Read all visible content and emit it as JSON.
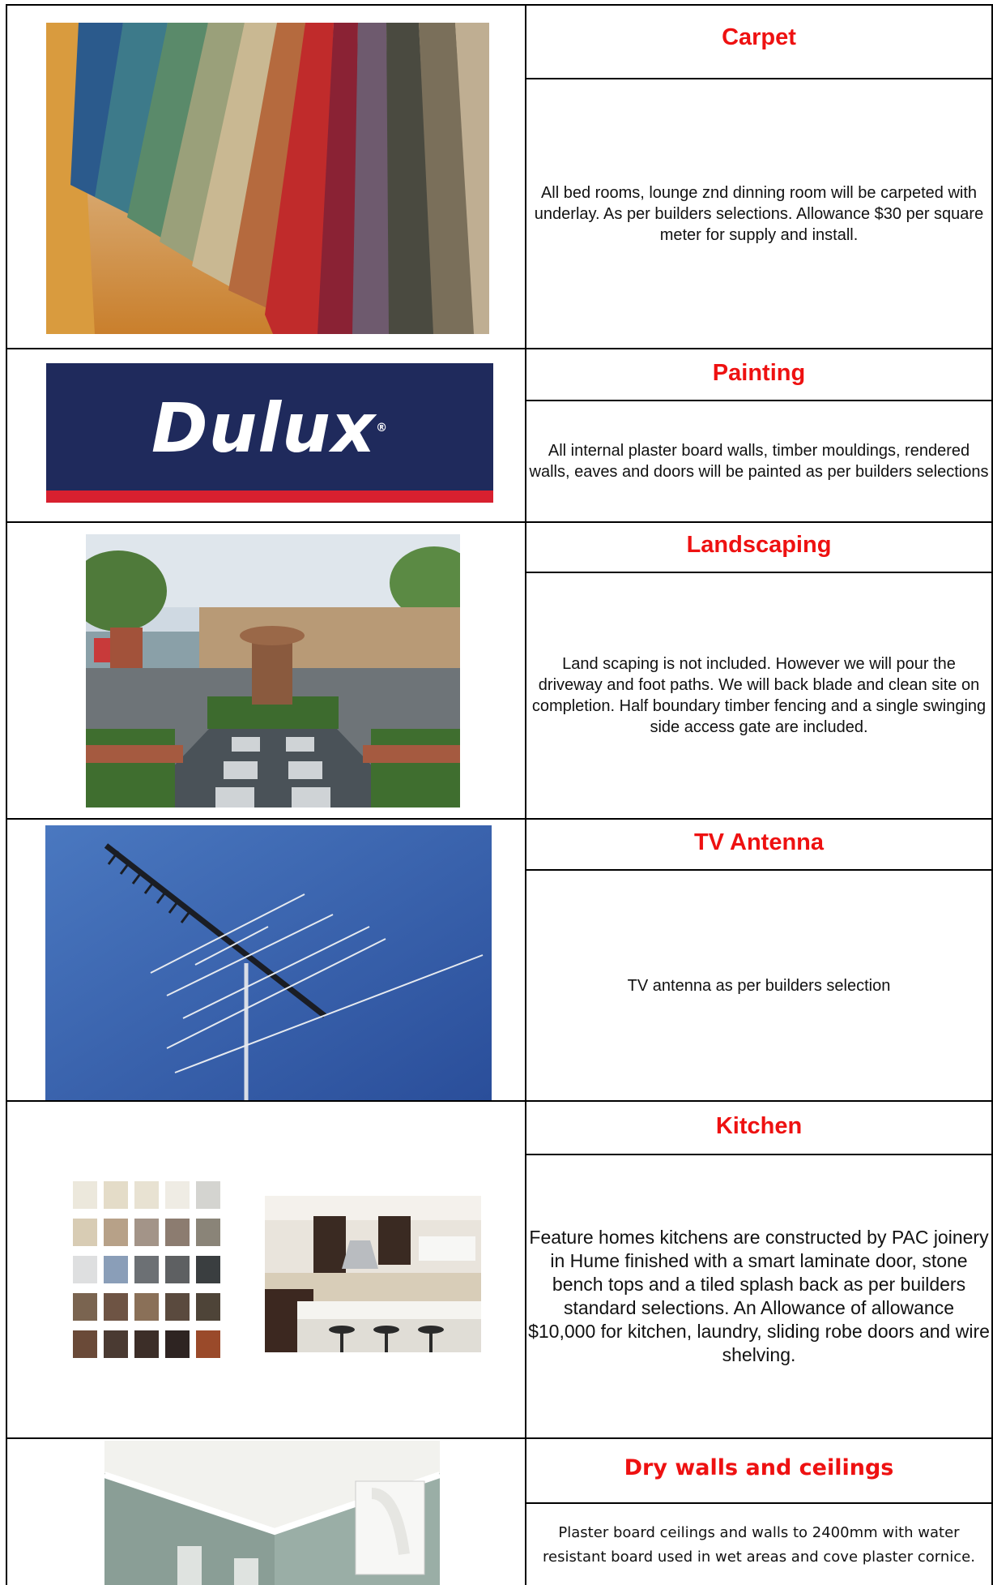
{
  "rows": [
    {
      "title": "Carpet",
      "description": "All bed rooms, lounge znd dinning room will be carpeted with underlay. As  per builders selections. Allowance $30 per square meter for supply and install.",
      "image": "carpet-swatches-image"
    },
    {
      "title": "Painting",
      "description": "All internal plaster board walls, timber mouldings, rendered walls, eaves and doors will be painted as per builders selections",
      "image": "dulux-logo",
      "logo_text": "Dulux",
      "logo_mark": "®",
      "brand_colors": {
        "navy": "#1f2a5c",
        "red": "#d8202f"
      }
    },
    {
      "title": "Landscaping",
      "description": "Land scaping is not included. However we will pour the driveway and foot paths. We will back blade and clean site on completion. Half boundary timber fencing and a single swinging side access gate are included.",
      "image": "landscaped-garden-image"
    },
    {
      "title": "TV Antenna",
      "description": "TV antenna as per builders selection",
      "image": "tv-antenna-image"
    },
    {
      "title": "Kitchen",
      "description": "Feature homes kitchens are constructed by PAC joinery in Hume finished with a smart laminate door, stone bench tops and a tiled splash back as per builders standard selections. An Allowance of allowance $10,000 for kitchen, laundry, sliding robe doors and wire shelving.",
      "image": "laminate-swatches-and-kitchen-image"
    },
    {
      "title": "Dry walls and ceilings",
      "description": "Plaster board ceilings and walls to 2400mm with water resistant board used in wet areas and cove plaster cornice.",
      "image": "ceiling-cornice-image"
    }
  ],
  "colors": {
    "title_red": "#ee1111",
    "border": "#000000"
  }
}
